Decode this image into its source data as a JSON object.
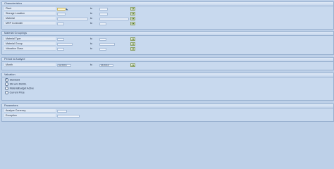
{
  "characteristics": {
    "title": "Characteristics",
    "to_label": "to",
    "rows": [
      {
        "label": "Plant",
        "from": "",
        "to": ""
      },
      {
        "label": "Storage Location",
        "from": "",
        "to": ""
      },
      {
        "label": "Material",
        "from": "",
        "to": ""
      },
      {
        "label": "MRP Controller",
        "from": "",
        "to": ""
      }
    ]
  },
  "material_groupings": {
    "title": "Material Groupings",
    "to_label": "to",
    "rows": [
      {
        "label": "Material Type",
        "from": "",
        "to": ""
      },
      {
        "label": "Material Group",
        "from": "",
        "to": ""
      },
      {
        "label": "Valuation Class",
        "from": "",
        "to": ""
      }
    ]
  },
  "period": {
    "title": "Period to Analyze",
    "to_label": "to",
    "month_label": "Month",
    "from": "04.2010",
    "to": "09.2010"
  },
  "valuation": {
    "title": "Valuation",
    "options": [
      "Standard",
      "Std w/o Distrib.",
      "Materialbudget Active",
      "Current Price"
    ],
    "selected_index": 0
  },
  "parameters": {
    "title": "Parameters",
    "rows": [
      {
        "label": "Analyze Currency",
        "value": ""
      },
      {
        "label": "Exception",
        "value": ""
      }
    ]
  },
  "icons": {
    "multiple_selection": "multiple-selection-arrow-icon",
    "help": "f4-help-icon"
  }
}
